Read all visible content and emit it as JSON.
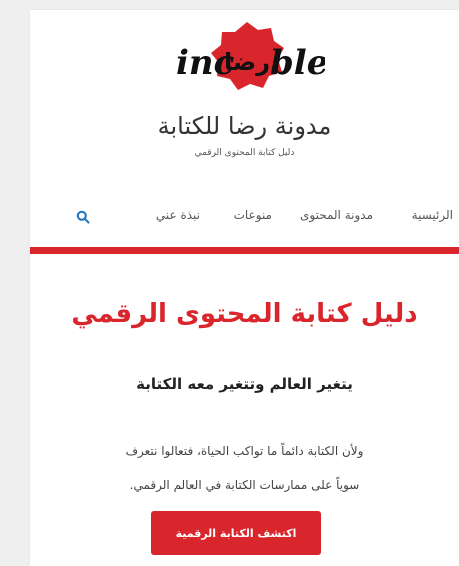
{
  "brand": {
    "logo_text_left": "inc",
    "logo_text_center": "رضا",
    "logo_text_right": "ble",
    "site_title": "مدونة رضا للكتابة",
    "tagline": "دليل كتابة المحتوى الرقمي"
  },
  "nav": {
    "items": [
      {
        "label": "الرئيسية"
      },
      {
        "label": "مدونة المحتوى"
      },
      {
        "label": "منوعات"
      },
      {
        "label": "نبذة عني"
      }
    ],
    "search_icon": "search-icon"
  },
  "hero": {
    "headline": "دليل كتابة المحتوى الرقمي",
    "subheadline": "يتغير العالم وتتغير معه الكتابة",
    "body_line1": "ولأن الكتابة دائماً ما تواكب الحياة، فتعالوا نتعرف",
    "body_line2": "سوياً على ممارسات الكتابة في العالم الرقمي.",
    "cta_label": "اكتشف الكتابة الرقمية"
  },
  "colors": {
    "accent": "#d9262c",
    "nav_search": "#1e73be",
    "background": "#efefef"
  }
}
